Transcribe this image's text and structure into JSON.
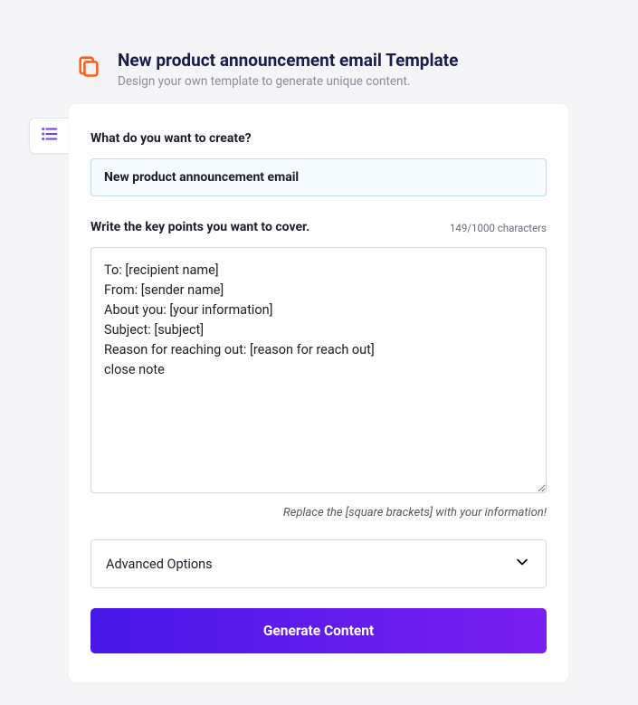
{
  "header": {
    "title": "New product announcement email Template",
    "subtitle": "Design your own template to generate unique content."
  },
  "form": {
    "field1_label": "What do you want to create?",
    "field1_value": "New product announcement email",
    "field2_label": "Write the key points you want to cover.",
    "char_info": "149/1000 characters",
    "keypoints_value": "To: [recipient name]\nFrom: [sender name]\nAbout you: [your information]\nSubject: [subject]\nReason for reaching out: [reason for reach out]\nclose note",
    "hint": "Replace the [square brackets] with your information!",
    "advanced_label": "Advanced Options",
    "generate_label": "Generate Content"
  }
}
